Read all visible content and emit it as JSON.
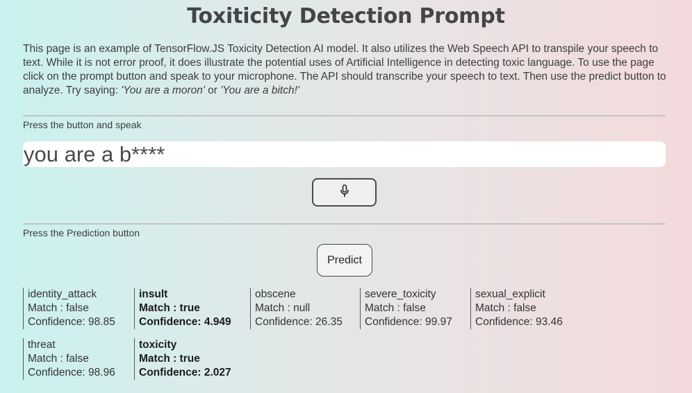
{
  "page": {
    "title": "Toxiticity Detection Prompt",
    "description_text": "This page is an example of TensorFlow.JS Toxicity Detection AI model. It also utilizes the Web Speech API to transpile your speech to text. While it is not error proof, it does illustrate the potential uses of Artificial Intelligence in detecting toxic language. To use the page click on the prompt button and speak to your microphone. The API should transcribe your speech to text. Then use the predict button to analyze. Try saying: ",
    "example_one": "'You are a moron'",
    "example_joiner": " or ",
    "example_two": "'You are a bitch!'"
  },
  "speech_section": {
    "label": "Press the button and speak",
    "transcript": "you are a b****",
    "mic_icon": "microphone-icon"
  },
  "prediction_section": {
    "label": "Press the Prediction button",
    "predict_label": "Predict"
  },
  "results": [
    {
      "label": "identity_attack",
      "match_text": "Match : false",
      "confidence_text": "Confidence: 98.85",
      "matched": false
    },
    {
      "label": "insult",
      "match_text": "Match : true",
      "confidence_text": "Confidence: 4.949",
      "matched": true
    },
    {
      "label": "obscene",
      "match_text": "Match : null",
      "confidence_text": "Confidence: 26.35",
      "matched": false
    },
    {
      "label": "severe_toxicity",
      "match_text": "Match : false",
      "confidence_text": "Confidence: 99.97",
      "matched": false
    },
    {
      "label": "sexual_explicit",
      "match_text": "Match : false",
      "confidence_text": "Confidence: 93.46",
      "matched": false
    },
    {
      "label": "threat",
      "match_text": "Match : false",
      "confidence_text": "Confidence: 98.96",
      "matched": false
    },
    {
      "label": "toxicity",
      "match_text": "Match : true",
      "confidence_text": "Confidence: 2.027",
      "matched": true
    }
  ]
}
